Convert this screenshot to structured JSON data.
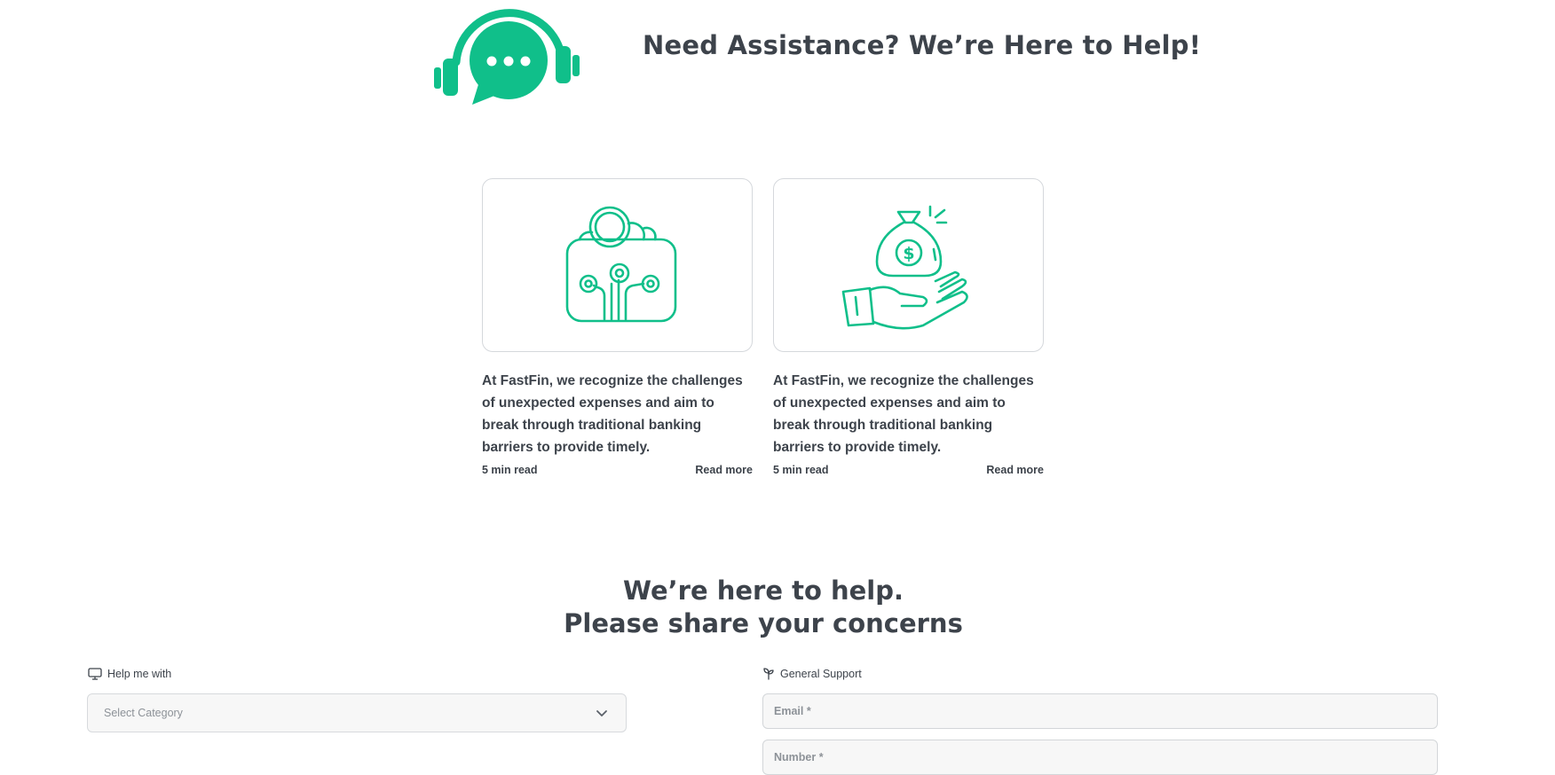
{
  "hero": {
    "title": "Need Assistance? We’re Here to Help!",
    "icon": "headset-chat-icon",
    "accent": "#10bf8a"
  },
  "cards": [
    {
      "illustration": "digital-wallet-icon",
      "text": "At FastFin, we recognize the challenges of unexpected expenses and aim to break through traditional banking barriers to provide timely.",
      "read_time": "5 min read",
      "link": "Read more"
    },
    {
      "illustration": "money-bag-hand-icon",
      "text": "At FastFin, we recognize the challenges of unexpected expenses and aim to break through traditional banking barriers to provide timely.",
      "read_time": "5 min read",
      "link": "Read more"
    }
  ],
  "form_section": {
    "title_line1": "We’re here to help.",
    "title_line2": "Please share your concerns",
    "help_label": "Help me with",
    "help_icon": "monitor-icon",
    "category_placeholder": "Select Category",
    "support_label": "General Support",
    "support_icon": "sprout-icon",
    "email_placeholder": "Email *",
    "number_placeholder": "Number *"
  },
  "colors": {
    "text": "#3d434b",
    "accent": "#10bf8a",
    "border": "#d5d8dc",
    "input_bg": "#f7f7f7",
    "placeholder": "#8d9298"
  }
}
